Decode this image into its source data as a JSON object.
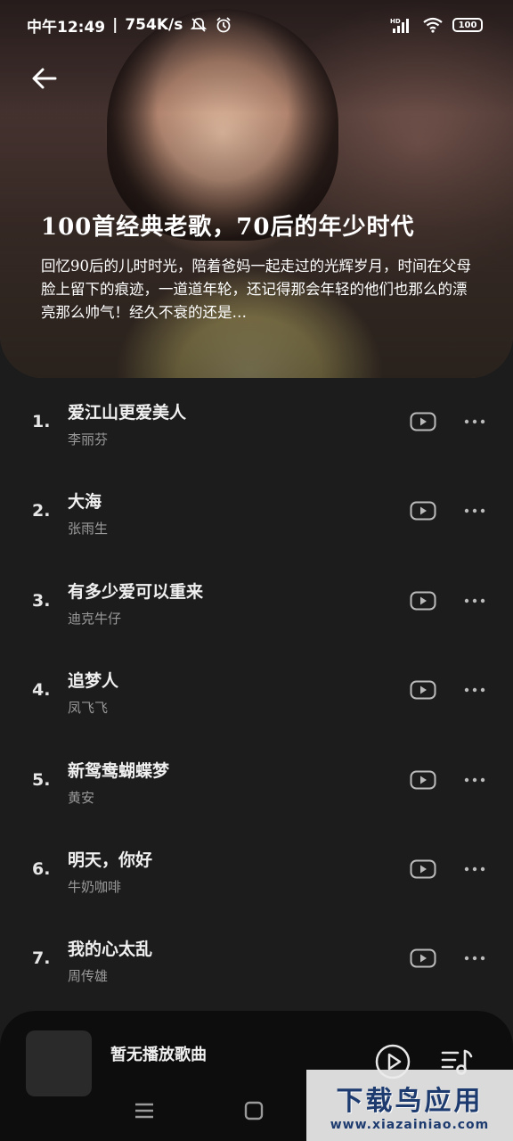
{
  "status_bar": {
    "time": "中午12:49",
    "separator": "|",
    "speed": "754K/s",
    "battery": "100",
    "hd_label": "HD"
  },
  "playlist": {
    "title": "100首经典老歌，70后的年少时代",
    "description": "回忆90后的儿时时光，陪着爸妈一起走过的光辉岁月，时间在父母脸上留下的痕迹，一道道年轮，还记得那会年轻的他们也那么的漂亮那么帅气！经久不衰的还是…"
  },
  "songs": [
    {
      "index": "1.",
      "name": "爱江山更爱美人",
      "artist": "李丽芬"
    },
    {
      "index": "2.",
      "name": "大海",
      "artist": "张雨生"
    },
    {
      "index": "3.",
      "name": "有多少爱可以重来",
      "artist": "迪克牛仔"
    },
    {
      "index": "4.",
      "name": "追梦人",
      "artist": "凤飞飞"
    },
    {
      "index": "5.",
      "name": "新鸳鸯蝴蝶梦",
      "artist": "黄安"
    },
    {
      "index": "6.",
      "name": "明天，你好",
      "artist": "牛奶咖啡"
    },
    {
      "index": "7.",
      "name": "我的心太乱",
      "artist": "周传雄"
    }
  ],
  "player": {
    "now_playing": "暂无播放歌曲"
  },
  "watermark": {
    "title": "下载鸟应用",
    "url": "www.xiazainiao.com"
  },
  "colors": {
    "background": "#1c1c1c",
    "player_bg": "#0d0d0d",
    "artist_text": "#9a9a9a",
    "watermark_text": "#1d3b6f"
  }
}
